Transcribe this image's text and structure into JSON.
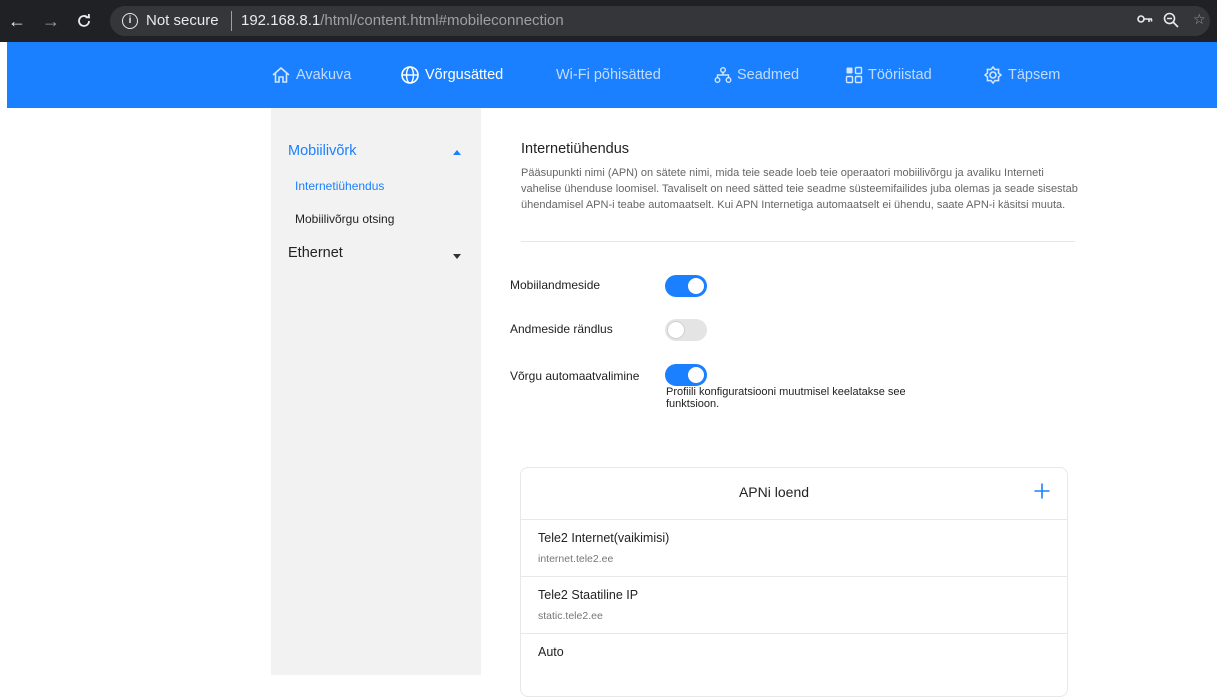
{
  "browser": {
    "security_label": "Not secure",
    "url_host": "192.168.8.1",
    "url_path": "/html/content.html#mobileconnection"
  },
  "topnav": {
    "items": [
      {
        "label": "Avakuva",
        "icon": "home-icon",
        "active": false
      },
      {
        "label": "Võrgusätted",
        "icon": "globe-icon",
        "active": true
      },
      {
        "label": "Wi-Fi põhisätted",
        "icon": "",
        "active": false
      },
      {
        "label": "Seadmed",
        "icon": "devices-icon",
        "active": false
      },
      {
        "label": "Tööriistad",
        "icon": "tools-grid-icon",
        "active": false
      },
      {
        "label": "Täpsem",
        "icon": "gear-icon",
        "active": false
      }
    ]
  },
  "sidebar": {
    "groups": [
      {
        "label": "Mobiilivõrk",
        "expanded": true,
        "items": [
          {
            "label": "Internetiühendus",
            "selected": true
          },
          {
            "label": "Mobiilivõrgu otsing",
            "selected": false
          }
        ]
      },
      {
        "label": "Ethernet",
        "expanded": false,
        "items": []
      }
    ]
  },
  "main": {
    "title": "Internetiühendus",
    "description": "Pääsupunkti nimi (APN) on sätete nimi, mida teie seade loeb teie operaatori mobiilivõrgu ja avaliku Interneti vahelise ühenduse loomisel. Tavaliselt on need sätted teie seadme süsteemifailides juba olemas ja seade sisestab ühendamisel APN-i teabe automaatselt. Kui APN Internetiga automaatselt ei ühendu, saate APN-i käsitsi muuta.",
    "settings": [
      {
        "label": "Mobiilandmeside",
        "on": true
      },
      {
        "label": "Andmeside rändlus",
        "on": false
      },
      {
        "label": "Võrgu automaatvalimine",
        "on": true
      }
    ],
    "auto_select_note": "Profiili konfiguratsiooni muutmisel keelatakse see funktsioon."
  },
  "apn_list": {
    "title": "APNi loend",
    "items": [
      {
        "name": "Tele2 Internet(vaikimisi)",
        "apn": "internet.tele2.ee"
      },
      {
        "name": "Tele2 Staatiline IP",
        "apn": "static.tele2.ee"
      },
      {
        "name": "Auto",
        "apn": ""
      }
    ]
  },
  "colors": {
    "accent": "#1a80ff",
    "sidebar_bg": "#f2f2f2",
    "browser_bg": "#202124"
  }
}
